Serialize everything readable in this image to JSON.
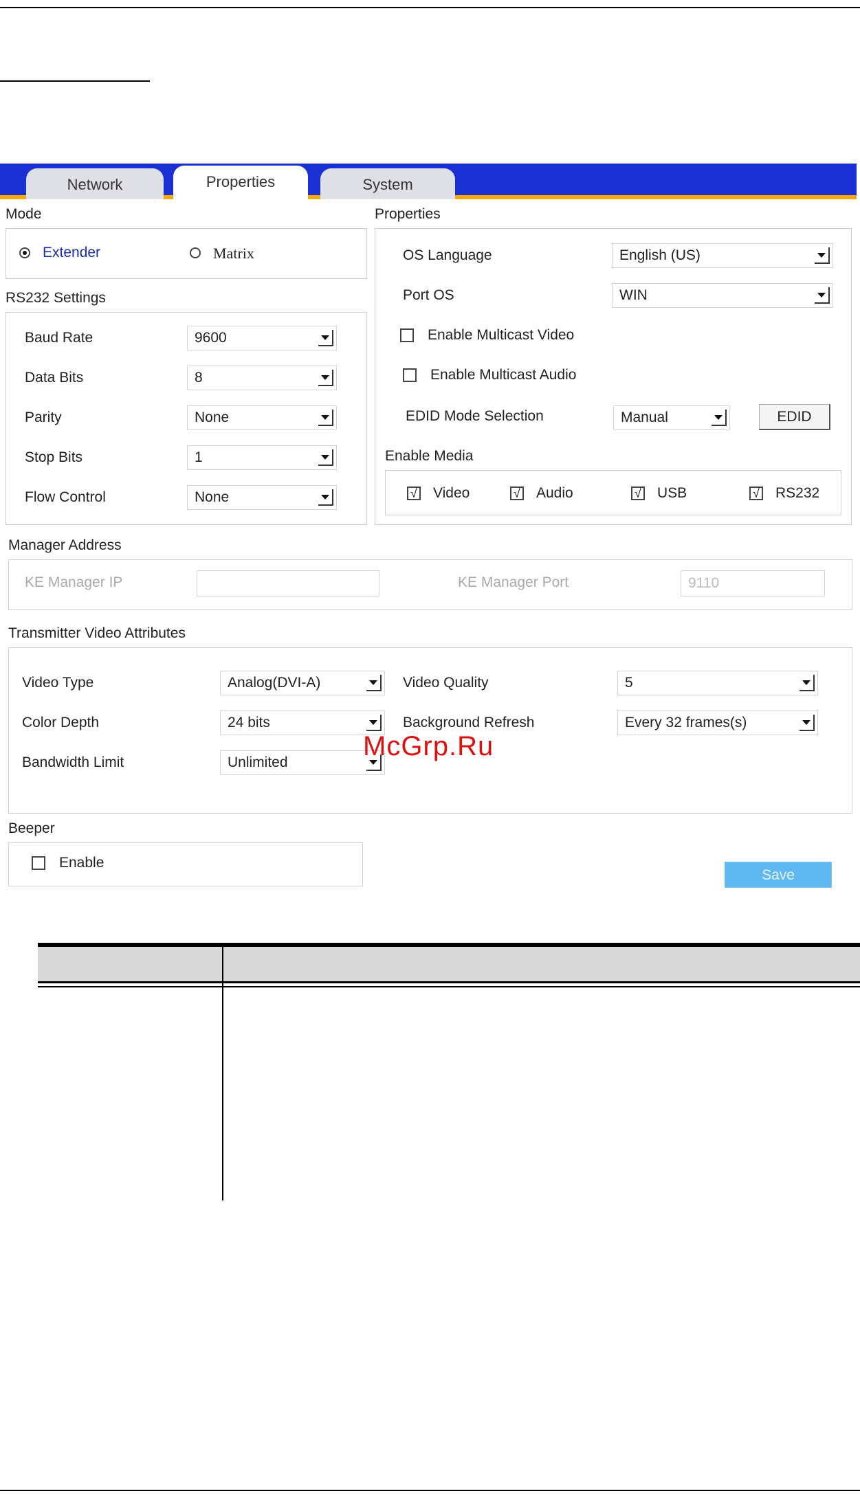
{
  "tabs": [
    {
      "label": "Network",
      "active": false
    },
    {
      "label": "Properties",
      "active": true
    },
    {
      "label": "System",
      "active": false
    }
  ],
  "mode": {
    "title": "Mode",
    "options": [
      {
        "label": "Extender",
        "selected": true
      },
      {
        "label": "Matrix",
        "selected": false
      }
    ]
  },
  "rs232": {
    "title": "RS232 Settings",
    "fields": [
      {
        "label": "Baud Rate",
        "value": "9600"
      },
      {
        "label": "Data Bits",
        "value": "8"
      },
      {
        "label": "Parity",
        "value": "None"
      },
      {
        "label": "Stop Bits",
        "value": "1"
      },
      {
        "label": "Flow Control",
        "value": "None"
      }
    ]
  },
  "properties": {
    "title": "Properties",
    "os_language_label": "OS Language",
    "os_language_value": "English (US)",
    "port_os_label": "Port OS",
    "port_os_value": "WIN",
    "multicast_video_label": "Enable Multicast Video",
    "multicast_video_checked": false,
    "multicast_audio_label": "Enable Multicast Audio",
    "multicast_audio_checked": false,
    "edid_label": "EDID Mode Selection",
    "edid_value": "Manual",
    "edid_button": "EDID"
  },
  "enable_media": {
    "title": "Enable Media",
    "items": [
      {
        "label": "Video",
        "checked": true
      },
      {
        "label": "Audio",
        "checked": true
      },
      {
        "label": "USB",
        "checked": true
      },
      {
        "label": "RS232",
        "checked": true
      }
    ],
    "check_glyph": "√"
  },
  "manager": {
    "title": "Manager Address",
    "ip_label": "KE Manager IP",
    "ip_value": "",
    "port_label": "KE Manager Port",
    "port_value": "9110"
  },
  "video": {
    "title": "Transmitter Video Attributes",
    "video_type_label": "Video Type",
    "video_type_value": "Analog(DVI-A)",
    "color_depth_label": "Color Depth",
    "color_depth_value": "24 bits",
    "bandwidth_label": "Bandwidth Limit",
    "bandwidth_value": "Unlimited",
    "quality_label": "Video Quality",
    "quality_value": "5",
    "refresh_label": "Background Refresh",
    "refresh_value": "Every 32 frames(s)"
  },
  "beeper": {
    "title": "Beeper",
    "enable_label": "Enable",
    "enable_checked": false
  },
  "save_label": "Save",
  "watermark": "McGrp.Ru",
  "colors": {
    "tabbar": "#1a2fd4",
    "tabbar_strip": "#f2a900",
    "save_button": "#5fb8f0",
    "watermark": "#dd1111"
  }
}
